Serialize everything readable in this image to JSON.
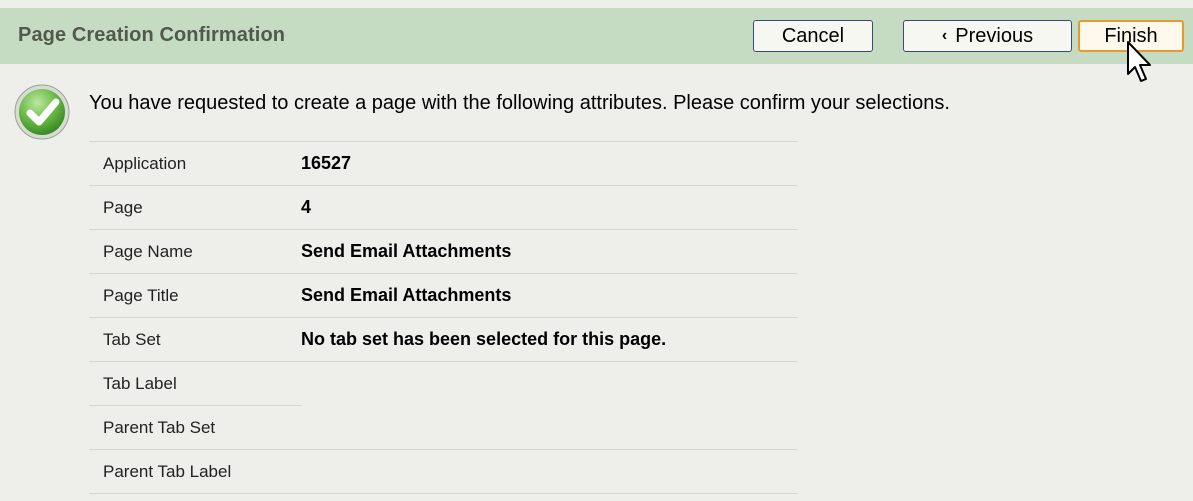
{
  "header": {
    "title": "Page Creation Confirmation",
    "cancel_label": "Cancel",
    "previous_chevron": "‹",
    "previous_label": "Previous",
    "finish_label": "Finish"
  },
  "icons": {
    "check": "check-circle-icon",
    "cursor": "mouse-pointer-icon"
  },
  "colors": {
    "header_background": "#c6dcc2",
    "page_background": "#eeeeea",
    "finish_border": "#e79a2d",
    "check_green": "#5aa83a"
  },
  "confirmation": {
    "message": "You have requested to create a page with the following attributes. Please confirm your selections."
  },
  "attributes": [
    {
      "label": "Application",
      "value": "16527"
    },
    {
      "label": "Page",
      "value": "4"
    },
    {
      "label": "Page Name",
      "value": "Send Email Attachments"
    },
    {
      "label": "Page Title",
      "value": "Send Email Attachments"
    },
    {
      "label": "Tab Set",
      "value": "No tab set has been selected for this page."
    },
    {
      "label": "Tab Label",
      "value": ""
    },
    {
      "label": "Parent Tab Set",
      "value": ""
    },
    {
      "label": "Parent Tab Label",
      "value": ""
    }
  ]
}
